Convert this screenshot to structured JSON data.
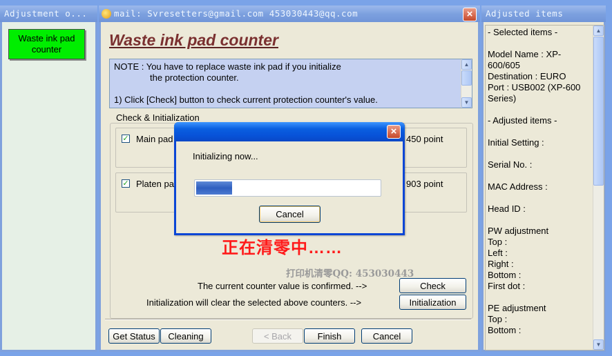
{
  "left_window": {
    "title": "Adjustment o...",
    "menu_items": [
      {
        "label": "Waste ink pad counter"
      }
    ]
  },
  "main_window": {
    "title": "mail: Svresetters@gmail.com  453030443@qq.com",
    "heading": "Waste ink pad counter",
    "note": {
      "line1": "NOTE : You have to replace waste ink pad if you initialize",
      "line2": "the protection counter.",
      "line3": "1) Click [Check] button to check current protection counter's value."
    },
    "group_title": "Check & Initialization",
    "counters": [
      {
        "label": "Main pad",
        "value": "450 point",
        "checked": true
      },
      {
        "label": "Platen pa",
        "value": "903 point",
        "checked": true
      }
    ],
    "overlay_chinese": "正在清零中……",
    "watermark": "打印机清零QQ: 453030443",
    "confirm_text": "The current counter value is confirmed. -->",
    "init_text": "Initialization will clear the selected above counters. -->",
    "check_button": "Check",
    "initialization_button": "Initialization",
    "bottom_buttons": {
      "get_status": "Get Status",
      "cleaning": "Cleaning",
      "back": "< Back",
      "finish": "Finish",
      "cancel": "Cancel"
    }
  },
  "dialog": {
    "message": "Initializing now...",
    "progress": 0.2,
    "cancel_label": "Cancel"
  },
  "right_window": {
    "title": "Adjusted items",
    "lines": [
      "- Selected items -",
      "",
      "Model Name : XP-",
      "600/605",
      "Destination : EURO",
      "Port : USB002 (XP-600",
      "Series)",
      "",
      "- Adjusted items -",
      "",
      "Initial Setting :",
      "",
      "Serial No. :",
      "",
      "MAC Address :",
      "",
      "Head ID :",
      "",
      "PW adjustment",
      "Top :",
      "Left :",
      "Right :",
      "Bottom :",
      "First dot :",
      "",
      "PE adjustment",
      "Top :",
      "Bottom :"
    ]
  }
}
